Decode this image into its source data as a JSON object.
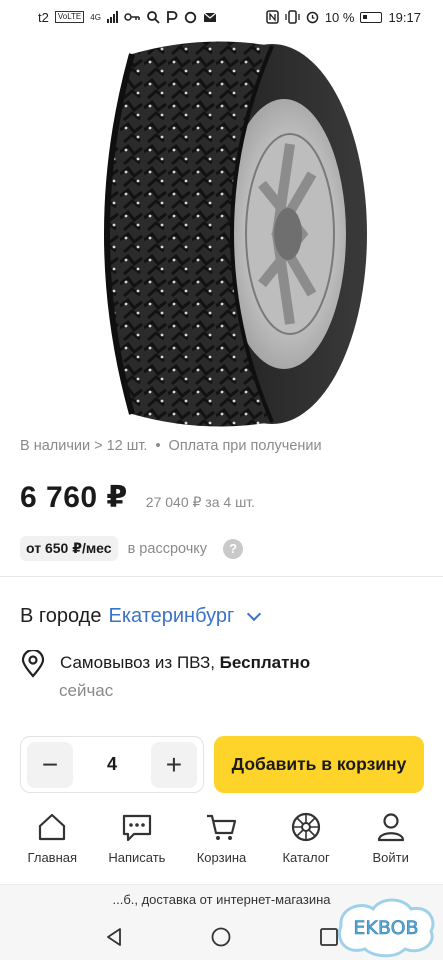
{
  "status_bar": {
    "carrier": "t2",
    "volte": "VoLTE",
    "network": "4G",
    "battery": "10 %",
    "time": "19:17"
  },
  "product": {
    "availability": "В наличии > 12 шт.",
    "payment": "Оплата при получении",
    "price": "6 760 ₽",
    "total_price": "27 040 ₽ за 4 шт.",
    "installment_amount": "от 650 ₽/мес",
    "installment_label": "в рассрочку"
  },
  "delivery": {
    "city_prefix": "В городе",
    "city": "Екатеринбург",
    "pickup_text": "Самовывоз из ПВЗ, ",
    "pickup_price": "Бесплатно",
    "pickup_time": "сейчас"
  },
  "cart": {
    "minus": "−",
    "quantity": "4",
    "plus": "+",
    "add_button": "Добавить в корзину"
  },
  "nav": {
    "items": [
      {
        "label": "Главная",
        "icon": "home-icon"
      },
      {
        "label": "Написать",
        "icon": "chat-icon"
      },
      {
        "label": "Корзина",
        "icon": "cart-icon"
      },
      {
        "label": "Каталог",
        "icon": "catalog-icon"
      },
      {
        "label": "Войти",
        "icon": "user-icon"
      }
    ]
  },
  "snippet": "...б., доставка от интернет-магазина",
  "watermark": "EKBOB",
  "colors": {
    "accent_yellow": "#fed42b",
    "link_blue": "#3a73c9",
    "muted_text": "#8a8a8a"
  }
}
